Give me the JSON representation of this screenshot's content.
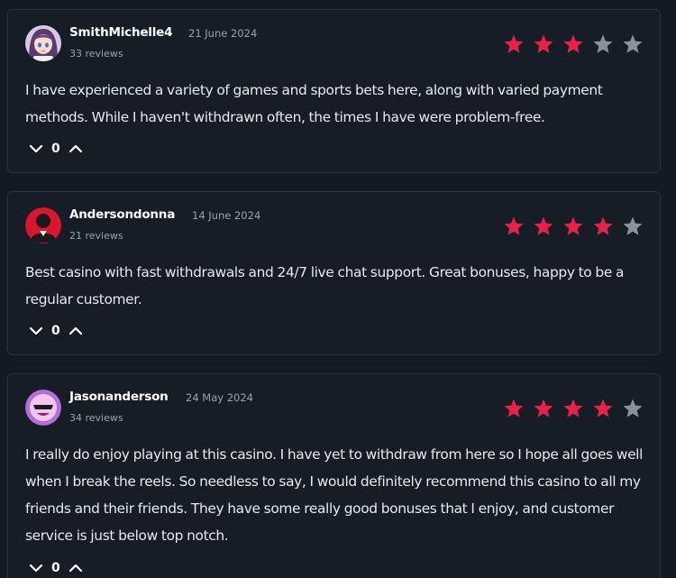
{
  "colors": {
    "background": "#141a24",
    "card": "#171d27",
    "star_filled": "#e5224a",
    "star_empty": "#8b919a"
  },
  "reviews": [
    {
      "name": "SmithMichelle4",
      "date": "21 June 2024",
      "reviews_count": "33 reviews",
      "rating": 3,
      "text": "I have experienced a variety of games and sports bets here, along with varied payment methods. While I haven't withdrawn often, the times I have were problem-free.",
      "votes": "0",
      "avatar_icon": "anime-girl-avatar-icon"
    },
    {
      "name": "Andersondonna",
      "date": "14 June 2024",
      "reviews_count": "21 reviews",
      "rating": 4,
      "text": "Best casino with fast withdrawals and 24/7 live chat support. Great bonuses, happy to be a regular customer.",
      "votes": "0",
      "avatar_icon": "red-person-avatar-icon"
    },
    {
      "name": "Jasonanderson",
      "date": "24 May 2024",
      "reviews_count": "34 reviews",
      "rating": 4,
      "text": "I really do enjoy playing at this casino. I have yet to withdraw from here so I hope all goes well when I break the reels. So needless to say, I would definitely recommend this casino to all my friends and their friends. They have some really good bonuses that I enjoy, and customer service is just below top notch.",
      "votes": "0",
      "avatar_icon": "purple-emoji-avatar-icon"
    }
  ]
}
